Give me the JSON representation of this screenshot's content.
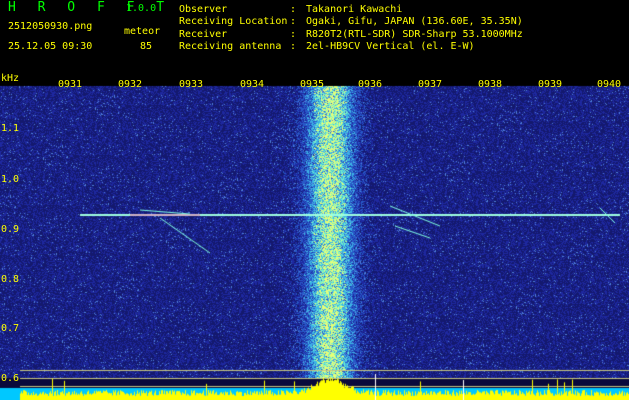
{
  "header": {
    "logo": "H R O F F T",
    "version": "1.0.0",
    "filename": "2512050930.png",
    "datetime": "25.12.05 09:30",
    "meteor_label": "meteor",
    "meteor_count": "85",
    "info": [
      {
        "label": "Observer",
        "value": "Takanori Kawachi"
      },
      {
        "label": "Receiving Location",
        "value": "Ogaki, Gifu, JAPAN (136.60E, 35.35N)"
      },
      {
        "label": "Receiver",
        "value": "R820T2(RTL-SDR) SDR-Sharp 53.1000MHz"
      },
      {
        "label": "Receiving antenna",
        "value": "2el-HB9CV Vertical (el. E-W)"
      }
    ]
  },
  "spectrogram": {
    "unit_label": "kHz",
    "time_ticks": [
      "0931",
      "0932",
      "0933",
      "0934",
      "0935",
      "0936",
      "0937",
      "0938",
      "0939",
      "0940"
    ],
    "freq_ticks": [
      "1.1",
      "1.0",
      "0.9",
      "0.8",
      "0.7",
      "0.6"
    ],
    "colors": {
      "background": "#1a1f7a",
      "carrier": "#00ffff",
      "echo": "#ffff00",
      "labels": "#ffff00"
    }
  }
}
